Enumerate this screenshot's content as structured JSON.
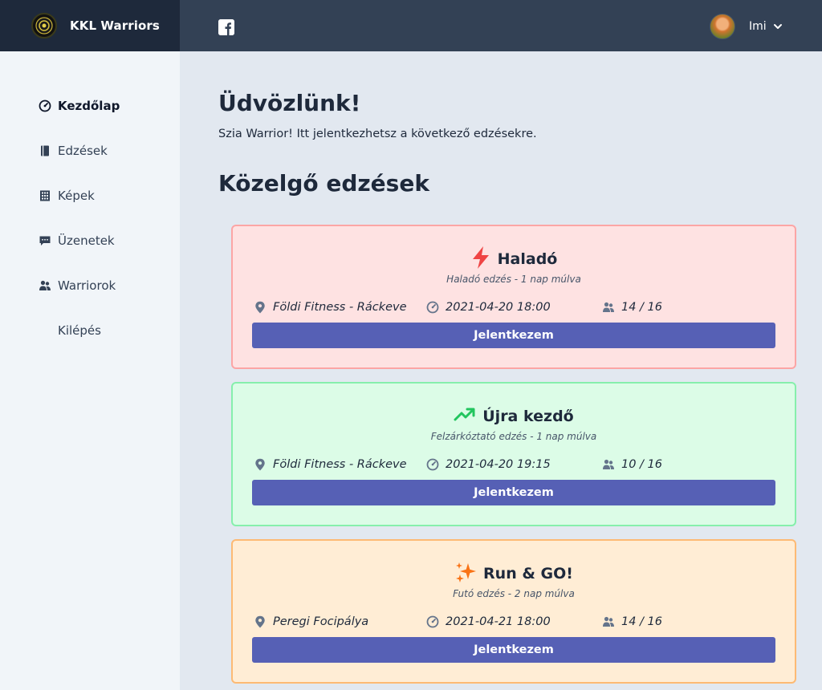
{
  "header": {
    "brand": "KKL Warriors",
    "user_name": "Imi"
  },
  "sidebar": {
    "items": [
      {
        "label": "Kezdőlap",
        "icon": "dashboard-icon",
        "active": true
      },
      {
        "label": "Edzések",
        "icon": "book-icon",
        "active": false
      },
      {
        "label": "Képek",
        "icon": "grid-icon",
        "active": false
      },
      {
        "label": "Üzenetek",
        "icon": "chat-icon",
        "active": false
      },
      {
        "label": "Warriorok",
        "icon": "users-icon",
        "active": false
      },
      {
        "label": "Kilépés",
        "icon": "",
        "active": false
      }
    ]
  },
  "main": {
    "title": "Üdvözlünk!",
    "subtitle": "Szia Warrior! Itt jelentkezhetsz a következő edzésekre.",
    "section_title": "Közelgő edzések",
    "trainings": [
      {
        "title": "Haladó",
        "icon": "lightning-icon",
        "subtitle": "Haladó edzés - 1 nap múlva",
        "location": "Földi Fitness - Ráckeve",
        "datetime": "2021-04-20 18:00",
        "capacity": "14 / 16",
        "button": "Jelentkezem",
        "bg": "#fee2e2",
        "border": "#fca5a5"
      },
      {
        "title": "Újra kezdő",
        "icon": "trending-up-icon",
        "subtitle": "Felzárkóztató edzés - 1 nap múlva",
        "location": "Földi Fitness - Ráckeve",
        "datetime": "2021-04-20 19:15",
        "capacity": "10 / 16",
        "button": "Jelentkezem",
        "bg": "#dcfce7",
        "border": "#86efac"
      },
      {
        "title": "Run & GO!",
        "icon": "sparkles-icon",
        "subtitle": "Futó edzés - 2 nap múlva",
        "location": "Peregi Focipálya",
        "datetime": "2021-04-21 18:00",
        "capacity": "14 / 16",
        "button": "Jelentkezem",
        "bg": "#ffedd5",
        "border": "#fdba74"
      }
    ]
  },
  "colors": {
    "button": "#5660b5",
    "lightning": "#ef4444",
    "trending": "#22c55e",
    "sparkles": "#f97316"
  }
}
